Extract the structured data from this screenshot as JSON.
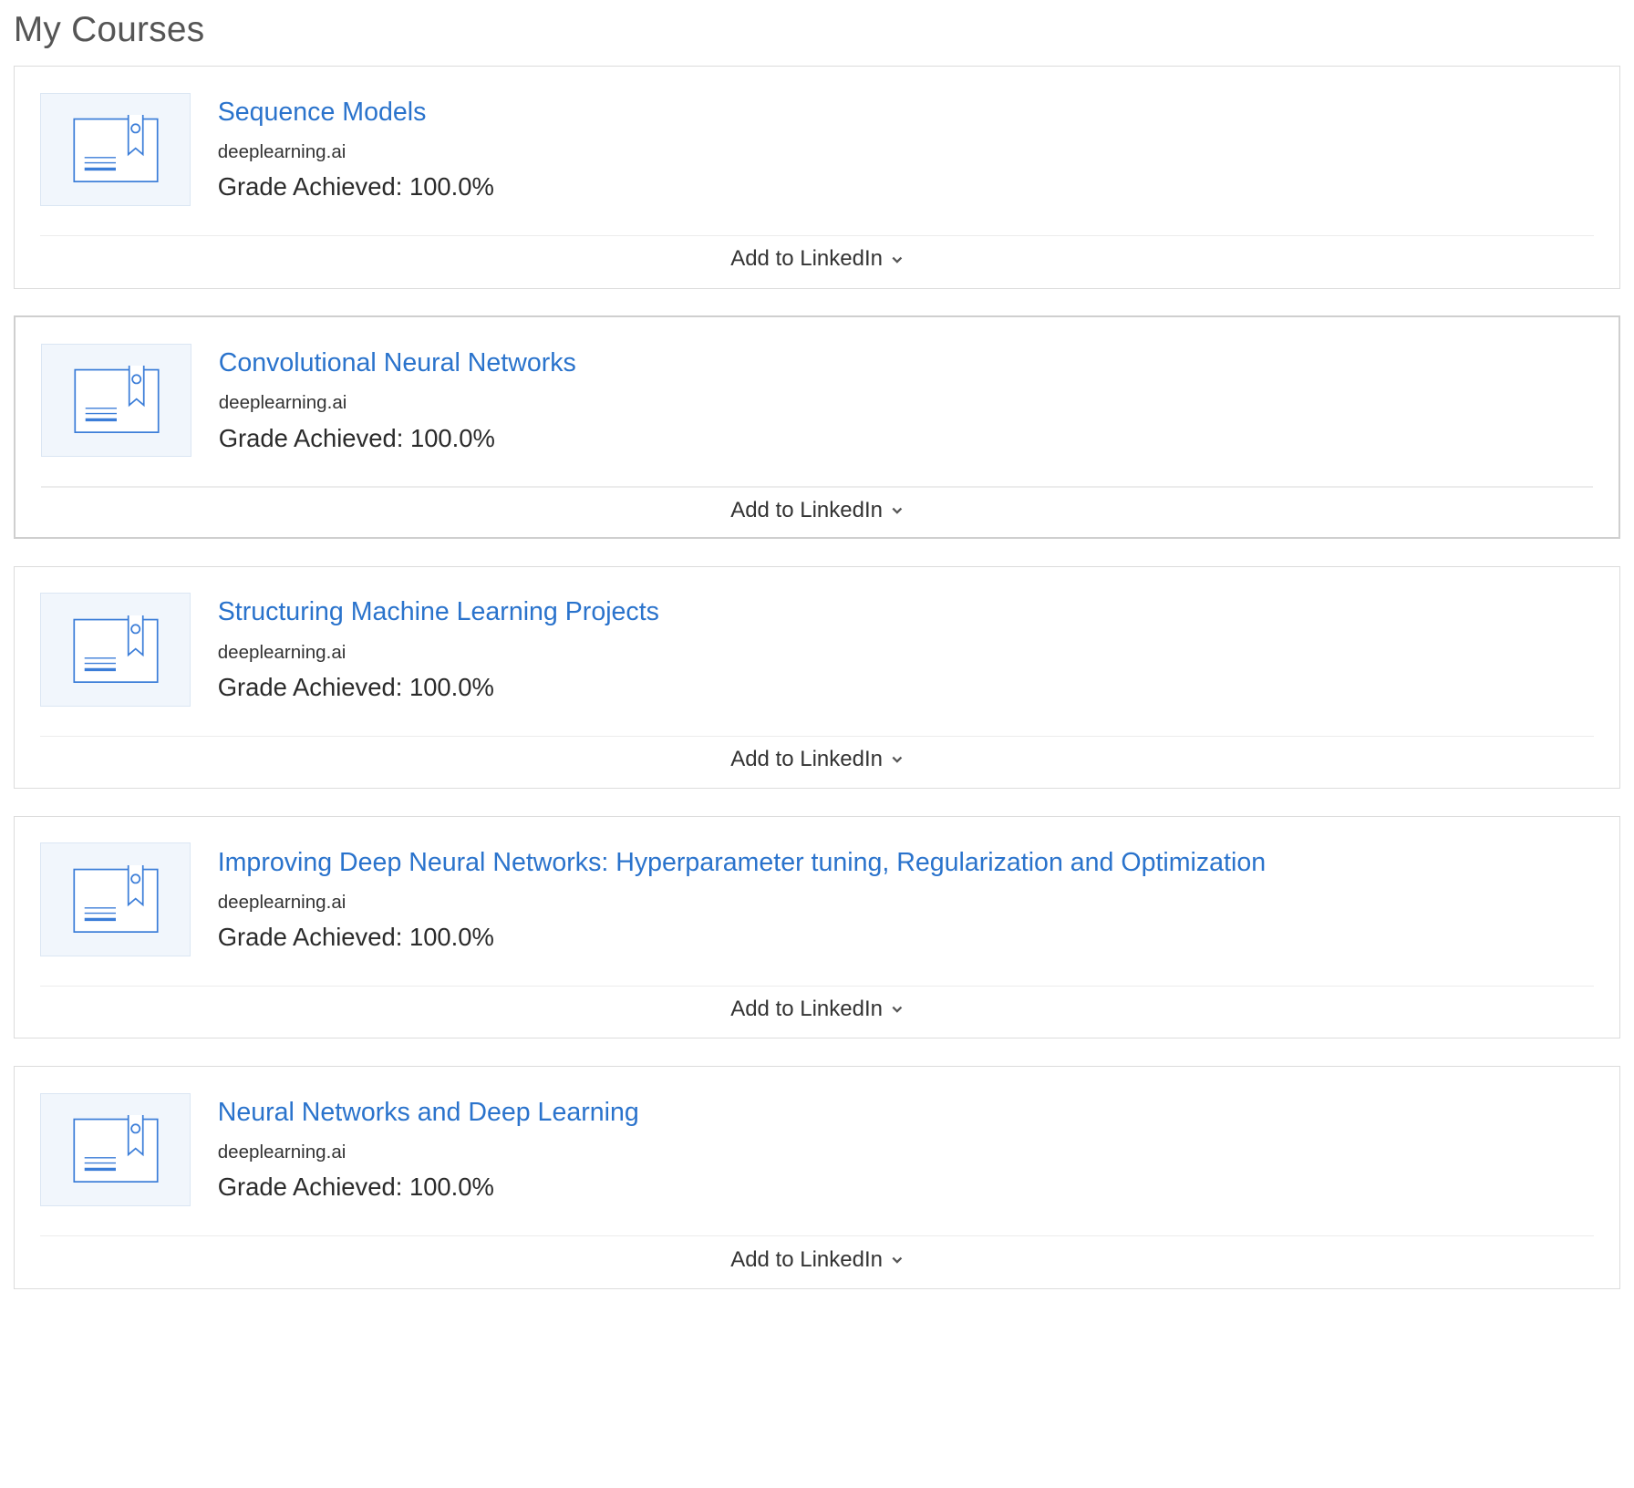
{
  "page": {
    "heading": "My Courses"
  },
  "courses": [
    {
      "title": "Sequence Models",
      "partner": "deeplearning.ai",
      "grade": "Grade Achieved: 100.0%",
      "linkedin_label": "Add to LinkedIn"
    },
    {
      "title": "Convolutional Neural Networks",
      "partner": "deeplearning.ai",
      "grade": "Grade Achieved: 100.0%",
      "linkedin_label": "Add to LinkedIn"
    },
    {
      "title": "Structuring Machine Learning Projects",
      "partner": "deeplearning.ai",
      "grade": "Grade Achieved: 100.0%",
      "linkedin_label": "Add to LinkedIn"
    },
    {
      "title": "Improving Deep Neural Networks: Hyperparameter tuning, Regularization and Optimization",
      "partner": "deeplearning.ai",
      "grade": "Grade Achieved: 100.0%",
      "linkedin_label": "Add to LinkedIn"
    },
    {
      "title": "Neural Networks and Deep Learning",
      "partner": "deeplearning.ai",
      "grade": "Grade Achieved: 100.0%",
      "linkedin_label": "Add to LinkedIn"
    }
  ],
  "icons": {
    "thumbnail": "certificate-icon",
    "dropdown": "chevron-down-icon"
  },
  "colors": {
    "link": "#2a73cc",
    "icon_stroke": "#3b7dd8",
    "thumb_bg": "#f1f6fc",
    "card_border": "#dcdcdc"
  }
}
